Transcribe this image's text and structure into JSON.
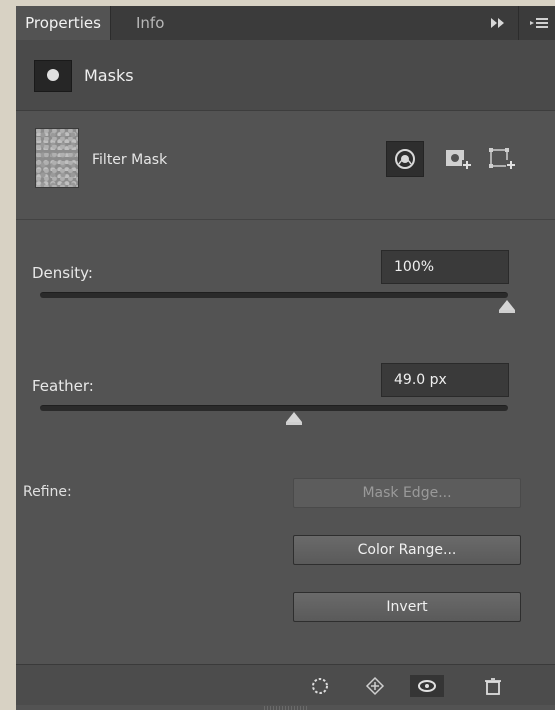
{
  "tabs": {
    "properties": "Properties",
    "info": "Info"
  },
  "header": {
    "forward_icon": "double-chevron-right-icon",
    "menu_icon": "panel-menu-icon"
  },
  "masks": {
    "label": "Masks"
  },
  "filter": {
    "label": "Filter Mask"
  },
  "density": {
    "label": "Density:",
    "value": "100%",
    "level_percent": 100
  },
  "feather": {
    "label": "Feather:",
    "value": "49.0 px",
    "level_percent": 54
  },
  "refine": {
    "label": "Refine:",
    "mask_edge": "Mask Edge...",
    "color_range": "Color Range...",
    "invert": "Invert"
  }
}
